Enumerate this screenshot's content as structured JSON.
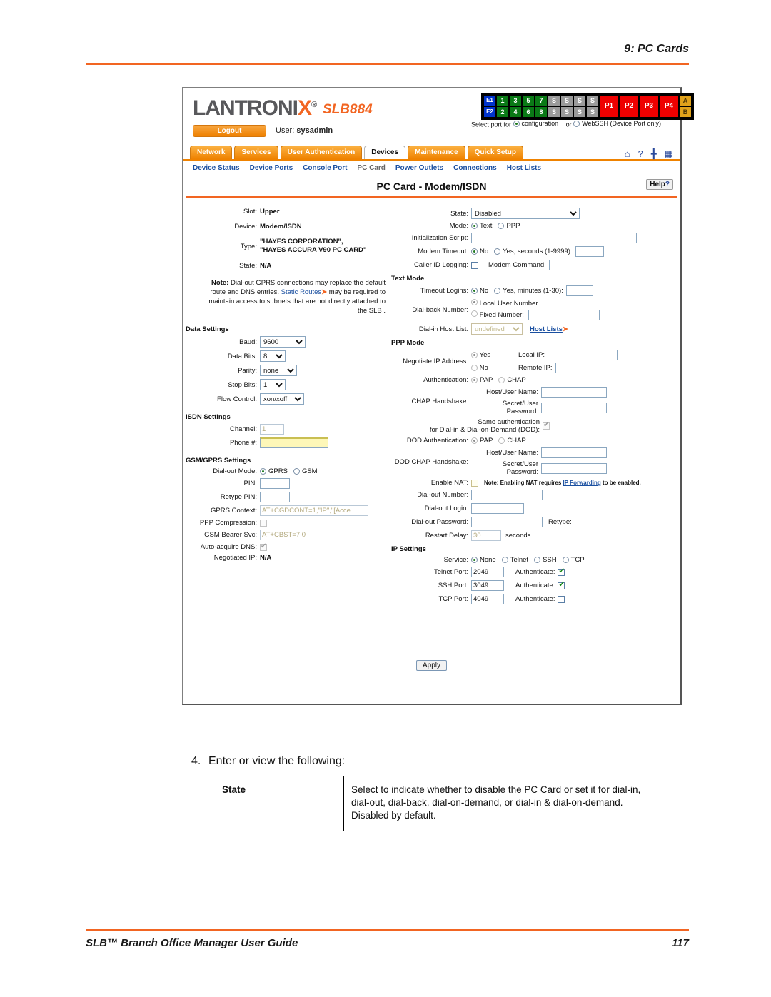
{
  "page": {
    "header": "9: PC Cards",
    "footer_title": "SLB™ Branch Office Manager User Guide",
    "footer_page": "117",
    "accent": "#f26522"
  },
  "app": {
    "logo": "LANTRONI",
    "logo_x": "X",
    "logo_reg": "®",
    "model": "SLB884",
    "logout_label": "Logout",
    "user_label": "User:",
    "user_name": "sysadmin",
    "ports": {
      "ethernet": [
        "E1",
        "E2"
      ],
      "device_top": [
        "1",
        "3",
        "5",
        "7"
      ],
      "device_bottom": [
        "2",
        "4",
        "6",
        "8"
      ],
      "serial_top": [
        "S",
        "S",
        "S",
        "S"
      ],
      "serial_bottom": [
        "S",
        "S",
        "S",
        "S"
      ],
      "power": [
        "P1",
        "P2",
        "P3",
        "P4"
      ],
      "ab": [
        "A",
        "B"
      ]
    },
    "select_port_prefix": "Select port for",
    "select_port_opt1": "configuration",
    "select_port_or": "or",
    "select_port_opt2": "WebSSH (Device Port only)",
    "select_port_selected": "configuration",
    "header_icons": [
      "home-icon",
      "help-icon",
      "sitemap-icon",
      "log-icon"
    ],
    "tabs": [
      {
        "label": "Network",
        "active": false
      },
      {
        "label": "Services",
        "active": false
      },
      {
        "label": "User Authentication",
        "active": false
      },
      {
        "label": "Devices",
        "active": true
      },
      {
        "label": "Maintenance",
        "active": false
      },
      {
        "label": "Quick Setup",
        "active": false
      }
    ],
    "subnav": [
      {
        "label": "Device Status",
        "current": false
      },
      {
        "label": "Device Ports",
        "current": false
      },
      {
        "label": "Console Port",
        "current": false
      },
      {
        "label": "PC Card",
        "current": true
      },
      {
        "label": "Power Outlets",
        "current": false
      },
      {
        "label": "Connections",
        "current": false
      },
      {
        "label": "Host Lists",
        "current": false
      }
    ],
    "panel_title": "PC Card - Modem/ISDN",
    "help_label": "Help",
    "help_mark": "?",
    "apply_label": "Apply"
  },
  "form": {
    "slot_label": "Slot:",
    "slot_value": "Upper",
    "device_label": "Device:",
    "device_value": "Modem/ISDN",
    "type_label": "Type:",
    "type_value_line1": "\"HAYES CORPORATION\",",
    "type_value_line2": "\"HAYES ACCURA V90 PC CARD\"",
    "state_label": "State:",
    "state_value": "N/A",
    "note_bold": "Note:",
    "note_text1": "Dial-out GPRS connections may replace the default route and DNS entries.",
    "note_link": "Static Routes",
    "note_text2": "may be required to maintain access to subnets that are not directly attached to the SLB .",
    "data_settings_heading": "Data Settings",
    "baud_label": "Baud:",
    "baud_value": "9600",
    "data_bits_label": "Data Bits:",
    "data_bits_value": "8",
    "parity_label": "Parity:",
    "parity_value": "none",
    "stop_bits_label": "Stop Bits:",
    "stop_bits_value": "1",
    "flow_control_label": "Flow Control:",
    "flow_control_value": "xon/xoff",
    "isdn_settings_heading": "ISDN Settings",
    "channel_label": "Channel:",
    "channel_value": "1",
    "phone_label": "Phone #:",
    "phone_value": "",
    "gsm_heading": "GSM/GPRS Settings",
    "dialout_mode_label": "Dial-out Mode:",
    "dialout_mode_opt1": "GPRS",
    "dialout_mode_opt2": "GSM",
    "dialout_mode_selected": "GPRS",
    "pin_label": "PIN:",
    "pin_value": "",
    "retype_pin_label": "Retype PIN:",
    "retype_pin_value": "",
    "gprs_context_label": "GPRS Context:",
    "gprs_context_value": "AT+CGDCONT=1,\"IP\",\"[Acce",
    "ppp_compression_label": "PPP Compression:",
    "ppp_compression_checked": false,
    "gsm_bearer_label": "GSM Bearer Svc:",
    "gsm_bearer_value": "AT+CBST=7,0",
    "auto_dns_label": "Auto-acquire DNS:",
    "auto_dns_checked": true,
    "negotiated_ip_label": "Negotiated IP:",
    "negotiated_ip_value": "N/A",
    "state_sel_label": "State:",
    "state_sel_value": "Disabled",
    "mode_label": "Mode:",
    "mode_opt1": "Text",
    "mode_opt2": "PPP",
    "mode_selected": "Text",
    "init_script_label": "Initialization Script:",
    "init_script_value": "",
    "modem_timeout_label": "Modem Timeout:",
    "modem_timeout_no": "No",
    "modem_timeout_yes": "Yes, seconds (1-9999):",
    "modem_timeout_selected": "No",
    "modem_timeout_value": "",
    "caller_id_label": "Caller ID Logging:",
    "caller_id_checked": false,
    "modem_command_label": "Modem Command:",
    "modem_command_value": "",
    "text_mode_heading": "Text Mode",
    "timeout_logins_label": "Timeout Logins:",
    "timeout_logins_no": "No",
    "timeout_logins_yes": "Yes, minutes (1-30):",
    "timeout_logins_selected": "No",
    "timeout_logins_value": "",
    "dialback_label": "Dial-back Number:",
    "dialback_opt1": "Local User Number",
    "dialback_opt2": "Fixed Number:",
    "dialback_selected": "Local User Number",
    "dialback_fixed_value": "",
    "dialin_hostlist_label": "Dial-in Host List:",
    "dialin_hostlist_value": "undefined",
    "hostlists_link": "Host Lists",
    "ppp_mode_heading": "PPP Mode",
    "negotiate_ip_label": "Negotiate IP Address:",
    "negotiate_yes": "Yes",
    "negotiate_no": "No",
    "negotiate_selected": "Yes",
    "local_ip_label": "Local IP:",
    "local_ip_value": "",
    "remote_ip_label": "Remote IP:",
    "remote_ip_value": "",
    "auth_label": "Authentication:",
    "auth_pap": "PAP",
    "auth_chap": "CHAP",
    "auth_selected": "PAP",
    "chap_handshake_label": "CHAP Handshake:",
    "host_user_name_label": "Host/User Name:",
    "chap_host_user_value": "",
    "secret_password_label": "Secret/User Password:",
    "chap_secret_value": "",
    "same_auth_line1": "Same authentication",
    "same_auth_line2": "for Dial-in & Dial-on-Demand (DOD):",
    "same_auth_checked": true,
    "dod_auth_label": "DOD Authentication:",
    "dod_auth_pap": "PAP",
    "dod_auth_chap": "CHAP",
    "dod_auth_selected": "PAP",
    "dod_chap_handshake_label": "DOD CHAP Handshake:",
    "dod_host_user_value": "",
    "dod_secret_value": "",
    "enable_nat_label": "Enable NAT:",
    "enable_nat_checked": false,
    "nat_note_pre": "Note: Enabling NAT requires",
    "nat_note_link": "IP Forwarding",
    "nat_note_post": "to be enabled.",
    "dialout_number_label": "Dial-out Number:",
    "dialout_number_value": "",
    "dialout_login_label": "Dial-out Login:",
    "dialout_login_value": "",
    "dialout_password_label": "Dial-out Password:",
    "dialout_password_value": "",
    "retype_label": "Retype:",
    "retype_value": "",
    "restart_delay_label": "Restart Delay:",
    "restart_delay_value": "30",
    "seconds_label": "seconds",
    "ip_settings_heading": "IP Settings",
    "service_label": "Service:",
    "service_none": "None",
    "service_telnet": "Telnet",
    "service_ssh": "SSH",
    "service_tcp": "TCP",
    "service_selected": "None",
    "telnet_port_label": "Telnet Port:",
    "telnet_port_value": "2049",
    "telnet_auth_label": "Authenticate:",
    "telnet_auth_checked": true,
    "ssh_port_label": "SSH Port:",
    "ssh_port_value": "3049",
    "ssh_auth_label": "Authenticate:",
    "ssh_auth_checked": true,
    "tcp_port_label": "TCP Port:",
    "tcp_port_value": "4049",
    "tcp_auth_label": "Authenticate:",
    "tcp_auth_checked": false
  },
  "doc": {
    "step_number": "4.",
    "step_text": "Enter or view the following:",
    "table": {
      "rows": [
        {
          "name": "State",
          "description": "Select to indicate whether to disable the PC Card or set it for dial-in, dial-out, dial-back, dial-on-demand, or dial-in & dial-on-demand. Disabled by default."
        }
      ]
    }
  }
}
